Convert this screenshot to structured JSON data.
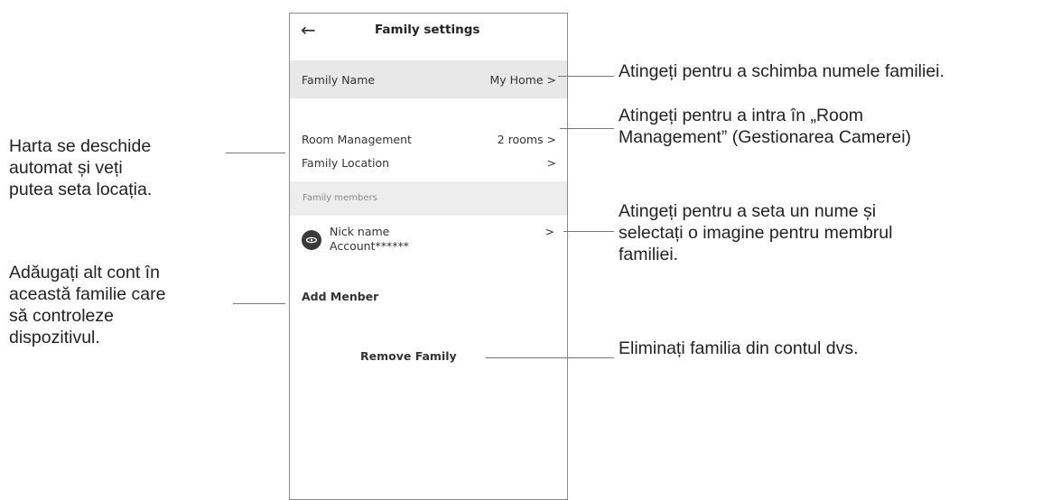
{
  "header": {
    "back_icon": "back-arrow-icon",
    "title": "Family settings"
  },
  "family_name": {
    "label": "Family Name",
    "value": "My Home >"
  },
  "room_management": {
    "label": "Room Management",
    "value": "2 rooms >"
  },
  "family_location": {
    "label": "Family Location",
    "value": ">"
  },
  "members_section": {
    "title": "Family members",
    "member": {
      "avatar_icon": "avatar-icon",
      "nick": "Nick name",
      "account": "Account******",
      "chevron": ">"
    }
  },
  "add_member": "Add Menber",
  "remove_family": "Remove Family",
  "annotations": {
    "family_name": [
      "Atingeți pentru a schimba numele familiei."
    ],
    "room_management": [
      "Atingeți pentru a intra în „Room",
      "Management” (Gestionarea Camerei)"
    ],
    "location": [
      "Harta se deschide",
      "automat și veți",
      "putea seta locația."
    ],
    "member": [
      "Atingeți pentru a seta un nume și",
      "selectați o imagine pentru membrul",
      "familiei."
    ],
    "add_member": [
      "Adăugați alt cont în",
      "această familie care",
      "să controleze",
      "dispozitivul."
    ],
    "remove_family": [
      "Eliminați familia din contul dvs."
    ]
  }
}
